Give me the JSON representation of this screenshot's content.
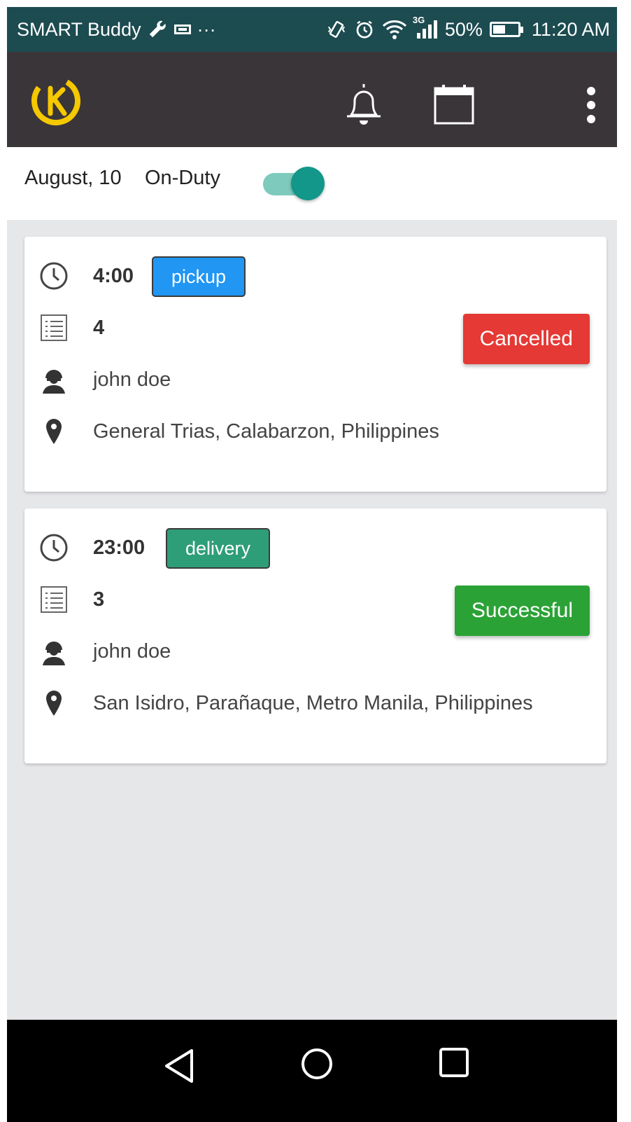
{
  "status_bar": {
    "carrier": "SMART Buddy",
    "extra": "···",
    "network": "3G",
    "battery_percent_label": "50%",
    "battery_level": 0.5,
    "time": "11:20 AM"
  },
  "app_bar": {
    "logo_icon": "k-bolt-logo-icon",
    "actions": [
      "bell-icon",
      "calendar-icon",
      "more-vertical-icon"
    ]
  },
  "duty": {
    "date": "August, 10",
    "label": "On-Duty",
    "on": true
  },
  "deliveries": [
    {
      "time": "4:00",
      "type": "pickup",
      "type_color": "#2196f3",
      "count": "4",
      "name": "john doe",
      "location": "General Trias, Calabarzon, Philippines",
      "status": "Cancelled",
      "status_color": "#e53935"
    },
    {
      "time": "23:00",
      "type": "delivery",
      "type_color": "#2e9e78",
      "count": "3",
      "name": "john doe",
      "location": "San Isidro, Parañaque, Metro Manila, Philippines",
      "status": "Successful",
      "status_color": "#2ba236"
    }
  ],
  "colors": {
    "status_bar_bg": "#1c4b50",
    "app_bar_bg": "#3a3539",
    "logo_yellow": "#f5c800",
    "toggle_on": "#12978a",
    "page_bg": "#e6e7e9"
  }
}
